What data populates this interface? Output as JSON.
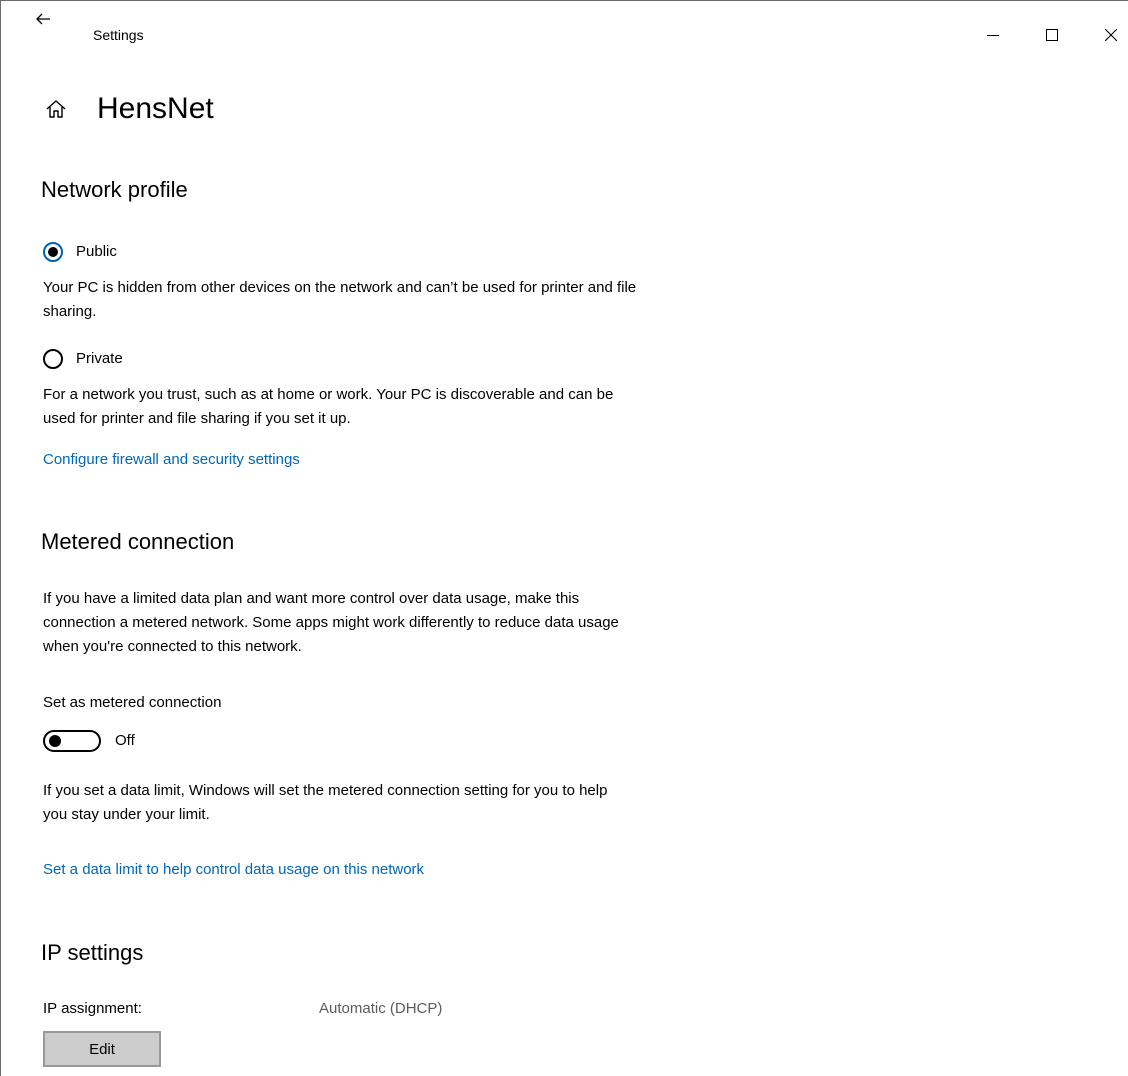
{
  "window": {
    "title": "Settings",
    "controls": {
      "minimize": "minimize-icon",
      "maximize": "maximize-icon",
      "close": "close-icon"
    }
  },
  "header": {
    "title": "HensNet",
    "icon": "home-icon"
  },
  "network_profile": {
    "title": "Network profile",
    "public": {
      "label": "Public",
      "selected": true,
      "description": "Your PC is hidden from other devices on the network and can’t be used for printer and file sharing."
    },
    "private": {
      "label": "Private",
      "selected": false,
      "description": "For a network you trust, such as at home or work. Your PC is discoverable and can be used for printer and file sharing if you set it up."
    },
    "firewall_link": "Configure firewall and security settings"
  },
  "metered": {
    "title": "Metered connection",
    "description": "If you have a limited data plan and want more control over data usage, make this connection a metered network. Some apps might work differently to reduce data usage when you're connected to this network.",
    "toggle_label": "Set as metered connection",
    "toggle_state": "Off",
    "toggle_on": false,
    "limit_note": "If you set a data limit, Windows will set the metered connection setting for you to help you stay under your limit.",
    "data_limit_link": "Set a data limit to help control data usage on this network"
  },
  "ip_settings": {
    "title": "IP settings",
    "assignment_label": "IP assignment:",
    "assignment_value": "Automatic (DHCP)",
    "edit_label": "Edit"
  },
  "colors": {
    "accent": "#0067b8",
    "radio_selected": "#0063b1",
    "button_bg": "#cccccc"
  }
}
